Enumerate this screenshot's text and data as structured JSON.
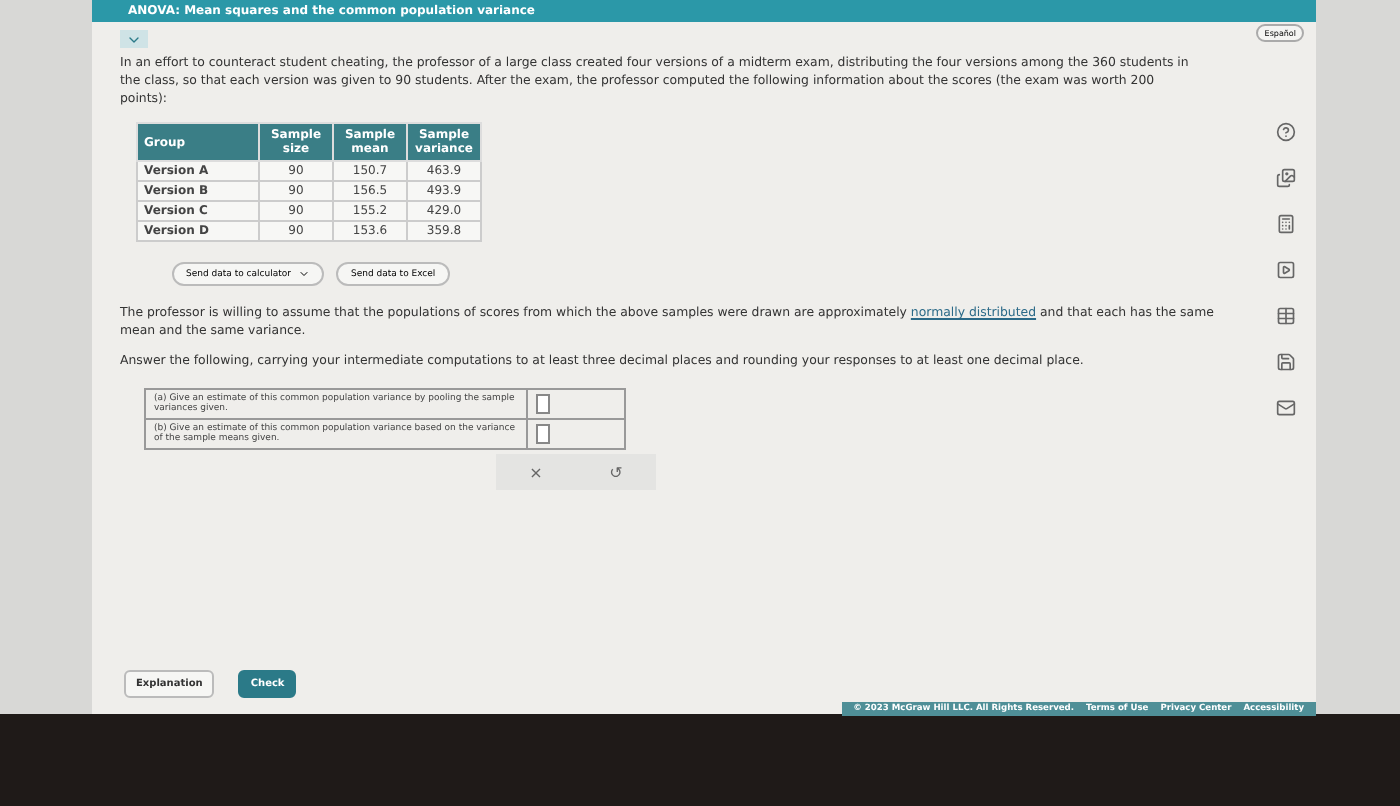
{
  "header": {
    "title": "ANOVA: Mean squares and the common population variance"
  },
  "language_button": "Español",
  "intro": "In an effort to counteract student cheating, the professor of a large class created four versions of a midterm exam, distributing the four versions among the 360 students in the class, so that each version was given to 90 students. After the exam, the professor computed the following information about the scores (the exam was worth 200 points):",
  "table": {
    "columns": [
      "Group",
      "Sample size",
      "Sample mean",
      "Sample variance"
    ],
    "rows": [
      [
        "Version A",
        "90",
        "150.7",
        "463.9"
      ],
      [
        "Version B",
        "90",
        "156.5",
        "493.9"
      ],
      [
        "Version C",
        "90",
        "155.2",
        "429.0"
      ],
      [
        "Version D",
        "90",
        "153.6",
        "359.8"
      ]
    ]
  },
  "send_buttons": [
    "Send data to calculator",
    "Send data to Excel"
  ],
  "assumption": {
    "before": "The professor is willing to assume that the populations of scores from which the above samples were drawn are approximately ",
    "link": "normally distributed",
    "after": " and that each has the same mean and the same variance."
  },
  "instructions": "Answer the following, carrying your intermediate computations to at least three decimal places and rounding your responses to at least one decimal place.",
  "questions": [
    {
      "text": "(a) Give an estimate of this common population variance by pooling the sample variances given."
    },
    {
      "text": "(b) Give an estimate of this common population variance based on the variance of the sample means given."
    }
  ],
  "action_buttons": [
    "×",
    "↺"
  ],
  "bottom_buttons": [
    "Explanation",
    "Check"
  ],
  "footer": [
    "© 2023 McGraw Hill LLC. All Rights Reserved.",
    "Terms of Use",
    "Privacy Center",
    "Accessibility"
  ]
}
